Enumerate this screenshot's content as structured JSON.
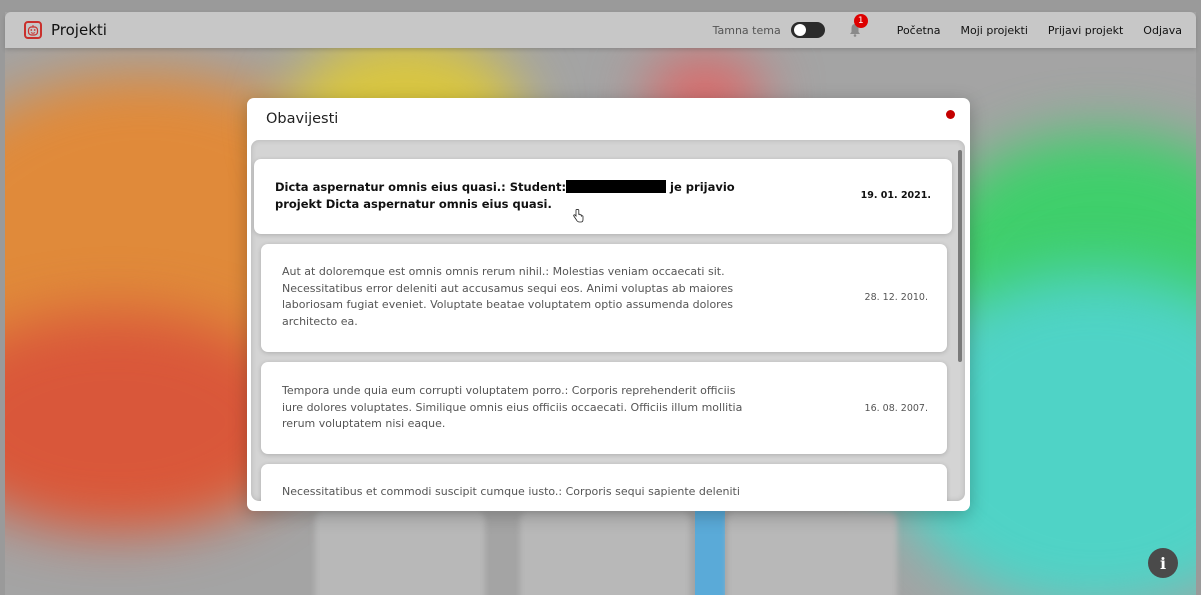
{
  "navbar": {
    "brand": "Projekti",
    "theme_label": "Tamna tema",
    "notification_count": "1",
    "links": [
      "Početna",
      "Moji projekti",
      "Prijavi projekt",
      "Odjava"
    ]
  },
  "modal": {
    "title": "Obavijesti",
    "notifications": [
      {
        "text_before": "Dicta aspernatur omnis eius quasi.: Student:",
        "text_after": " je prijavio projekt Dicta aspernatur omnis eius quasi.",
        "date": "19. 01. 2021.",
        "unread": true
      },
      {
        "text": "Aut at doloremque est omnis omnis rerum nihil.: Molestias veniam occaecati sit. Necessitatibus error deleniti aut accusamus sequi eos. Animi voluptas ab maiores laboriosam fugiat eveniet. Voluptate beatae voluptatem optio assumenda dolores architecto ea.",
        "date": "28. 12. 2010."
      },
      {
        "text": "Tempora unde quia eum corrupti voluptatem porro.: Corporis reprehenderit officiis iure dolores voluptates. Similique omnis eius officiis occaecati. Officiis illum mollitia rerum voluptatem nisi eaque.",
        "date": "16. 08. 2007."
      },
      {
        "text": "Necessitatibus et commodi suscipit cumque iusto.: Corporis sequi sapiente deleniti",
        "date": ""
      }
    ]
  },
  "colors": {
    "accent": "#c40000",
    "navbar_bg": "#c7c7c7"
  },
  "icons": {
    "logo": "robot-face-icon",
    "bell": "bell-icon",
    "info": "info-icon",
    "cursor": "hand-pointer-icon"
  }
}
